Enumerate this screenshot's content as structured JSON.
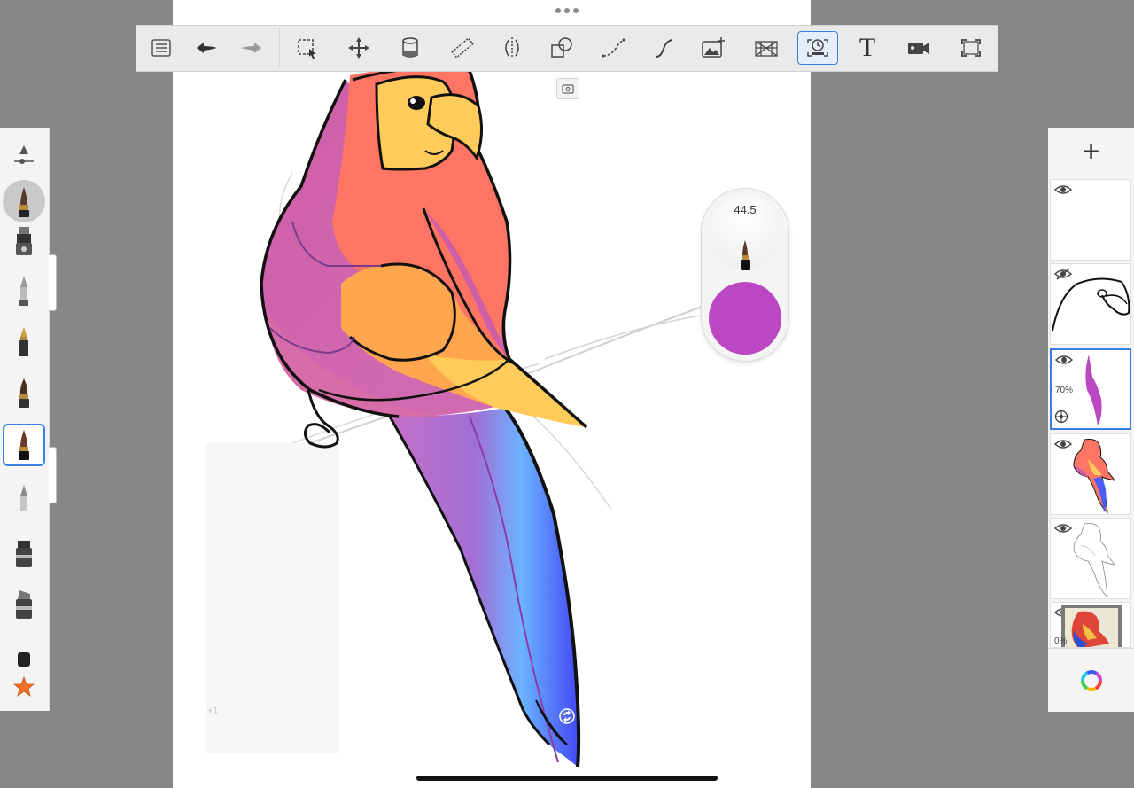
{
  "app": {
    "toolbar": {
      "tools": [
        {
          "name": "gallery-icon"
        },
        {
          "name": "undo-icon"
        },
        {
          "name": "redo-icon"
        },
        {
          "name": "selection-icon"
        },
        {
          "name": "transform-icon"
        },
        {
          "name": "fill-icon"
        },
        {
          "name": "ruler-icon"
        },
        {
          "name": "symmetry-icon"
        },
        {
          "name": "shapes-icon"
        },
        {
          "name": "curve-icon"
        },
        {
          "name": "stroke-icon"
        },
        {
          "name": "import-image-icon"
        },
        {
          "name": "perspective-icon"
        },
        {
          "name": "time-lapse-icon",
          "active": true
        },
        {
          "name": "text-tool-icon"
        },
        {
          "name": "video-icon"
        },
        {
          "name": "fullscreen-icon"
        }
      ],
      "text_tool_label": "T"
    },
    "brush_puck": {
      "size_value": "44.5",
      "color": "#bb47c2"
    },
    "brushes": [
      {
        "name": "size-slider-icon"
      },
      {
        "name": "paintbrush-current-icon",
        "current": true
      },
      {
        "name": "airbrush-icon"
      },
      {
        "name": "pencil-icon"
      },
      {
        "name": "fountain-pen-icon"
      },
      {
        "name": "paintbrush-icon"
      },
      {
        "name": "selected-brush-icon",
        "selected": true
      },
      {
        "name": "soft-pencil-icon"
      },
      {
        "name": "marker-icon"
      },
      {
        "name": "chisel-marker-icon"
      },
      {
        "name": "eraser-icon"
      },
      {
        "name": "favorites-star-icon"
      }
    ],
    "layers": {
      "add_label": "+",
      "items": [
        {
          "name": "layer-blank",
          "visible": true,
          "opacity": ""
        },
        {
          "name": "layer-outline-head",
          "visible": false,
          "opacity": ""
        },
        {
          "name": "layer-purple-stroke",
          "visible": true,
          "selected": true,
          "opacity": "70%"
        },
        {
          "name": "layer-colored-parrot",
          "visible": true,
          "opacity": ""
        },
        {
          "name": "layer-sketch-parrot",
          "visible": true,
          "opacity": ""
        },
        {
          "name": "layer-reference-image",
          "visible": true,
          "opacity": "0%"
        }
      ]
    },
    "canvas_hint": "+1",
    "colors": {
      "accent": "#3a7fe0",
      "parrot_red": "#ff7563",
      "parrot_magenta": "#cc5cac",
      "parrot_yellow": "#ffcb5a",
      "parrot_orange": "#ffa64f",
      "parrot_blue": "#4b5cf7",
      "parrot_violet": "#a86fd5"
    }
  }
}
